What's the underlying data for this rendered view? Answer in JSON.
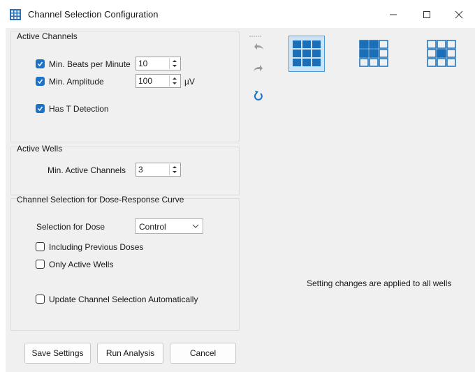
{
  "window": {
    "title": "Channel Selection Configuration",
    "minimize_icon": "minimize-icon",
    "maximize_icon": "maximize-icon",
    "close_icon": "close-icon"
  },
  "active_channels": {
    "legend": "Active Channels",
    "min_bpm": {
      "label": "Min. Beats per Minute",
      "checked": true,
      "value": "10"
    },
    "min_amplitude": {
      "label": "Min. Amplitude",
      "checked": true,
      "value": "100",
      "unit": "µV"
    },
    "t_detection": {
      "label": "Has T Detection",
      "checked": true
    }
  },
  "active_wells": {
    "legend": "Active Wells",
    "min_active_channels": {
      "label": "Min. Active Channels",
      "value": "3"
    }
  },
  "dose_response": {
    "legend": "Channel Selection for Dose-Response Curve",
    "selection_for_dose": {
      "label": "Selection for Dose",
      "value": "Control"
    },
    "including_previous": {
      "label": "Including Previous Doses",
      "checked": false
    },
    "only_active_wells": {
      "label": "Only Active Wells",
      "checked": false
    },
    "update_auto": {
      "label": "Update Channel Selection Automatically",
      "checked": false
    }
  },
  "buttons": {
    "save": "Save Settings",
    "run": "Run Analysis",
    "cancel": "Cancel"
  },
  "toolbar": [
    "undo-icon",
    "redo-icon",
    "reset-icon"
  ],
  "layouts": [
    {
      "name": "all-wells-layout-icon",
      "selected": true
    },
    {
      "name": "partial-wells-layout-icon",
      "selected": false
    },
    {
      "name": "single-well-layout-icon",
      "selected": false
    }
  ],
  "info_text": "Setting changes are applied to all wells",
  "colors": {
    "accent": "#1a73c9",
    "selected_bg": "#cce4f7",
    "selected_border": "#4a9ad8"
  }
}
